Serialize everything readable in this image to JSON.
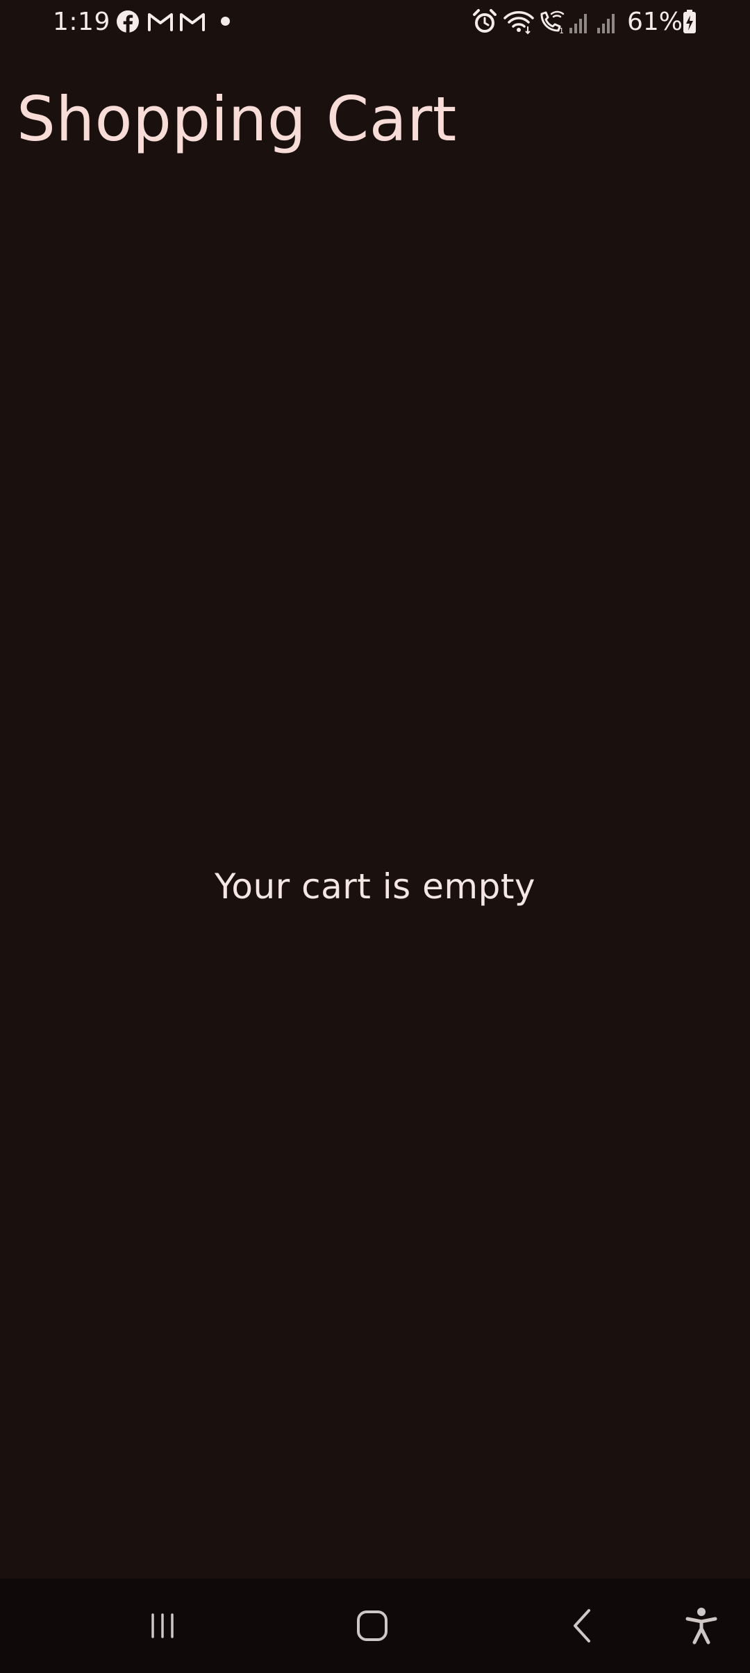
{
  "status_bar": {
    "time": "1:19",
    "battery_percent": "61%",
    "notification_icons": [
      "facebook-icon",
      "gmail-icon",
      "gmail-icon",
      "more-notifications-dot"
    ],
    "system_icons": [
      "alarm-icon",
      "wifi-icon",
      "wifi-calling-icon",
      "signal-icon",
      "signal-icon",
      "battery-charging-icon"
    ]
  },
  "header": {
    "title": "Shopping Cart"
  },
  "cart": {
    "empty_message": "Your cart is empty",
    "items": []
  },
  "nav_bar": {
    "buttons": [
      "recents-button",
      "home-button",
      "back-button",
      "accessibility-button"
    ]
  },
  "colors": {
    "background": "#1a110f",
    "title": "#f8dcd8",
    "text": "#f4e6e3",
    "nav_background": "#0f0a09"
  }
}
